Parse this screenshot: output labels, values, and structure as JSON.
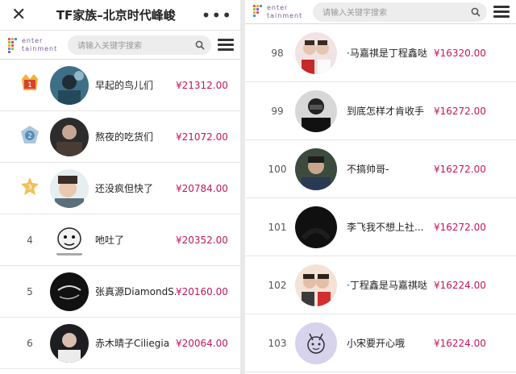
{
  "left": {
    "title": "TF家族–北京时代峰峻",
    "search_placeholder": "请输入关键字搜索",
    "logo_line1": "enter",
    "logo_line2": "tainment",
    "rows": [
      {
        "rank": "1",
        "name": "早起的鸟儿们",
        "amount": "¥21312.00",
        "medal": "gold"
      },
      {
        "rank": "2",
        "name": "熬夜的吃货们",
        "amount": "¥21072.00",
        "medal": "silver"
      },
      {
        "rank": "3",
        "name": "还没疯但快了",
        "amount": "¥20784.00",
        "medal": "bronze"
      },
      {
        "rank": "4",
        "name": "吔吐了",
        "amount": "¥20352.00",
        "medal": ""
      },
      {
        "rank": "5",
        "name": "张真源DiamondS...",
        "amount": "¥20160.00",
        "medal": ""
      },
      {
        "rank": "6",
        "name": "赤木晴子Ciliegia",
        "amount": "¥20064.00",
        "medal": ""
      }
    ]
  },
  "right": {
    "search_placeholder": "请输入关键字搜索",
    "logo_line1": "enter",
    "logo_line2": "tainment",
    "rows": [
      {
        "rank": "98",
        "name": "·马嘉祺是丁程鑫哒",
        "amount": "¥16320.00"
      },
      {
        "rank": "99",
        "name": "到底怎样才肯收手",
        "amount": "¥16272.00"
      },
      {
        "rank": "100",
        "name": "不搞帅哥-",
        "amount": "¥16272.00"
      },
      {
        "rank": "101",
        "name": "李飞我不想上社...",
        "amount": "¥16272.00"
      },
      {
        "rank": "102",
        "name": "·丁程鑫是马嘉祺哒",
        "amount": "¥16224.00"
      },
      {
        "rank": "103",
        "name": "小宋要开心哦",
        "amount": "¥16224.00"
      }
    ]
  },
  "colors": {
    "amount": "#c2185b",
    "logo": "#7a5a9a",
    "gold": "#f2b13a",
    "silver": "#a9c7de",
    "bronze": "#f0c15a"
  },
  "icons": {
    "close": "close-icon",
    "more": "more-icon",
    "search": "search-icon",
    "menu": "menu-icon"
  }
}
